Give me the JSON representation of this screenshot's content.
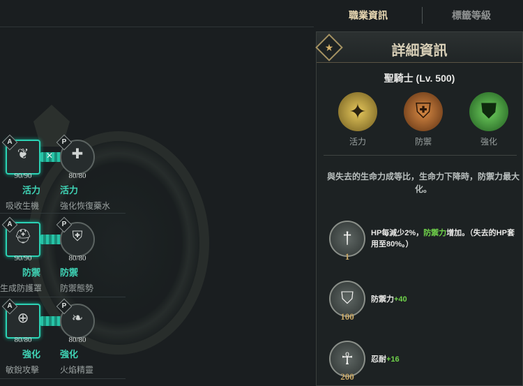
{
  "tabs": {
    "active": "職業資訊",
    "inactive": "標籤等級"
  },
  "panel": {
    "title": "詳細資訊",
    "class_name": "聖騎士 (Lv. 500)",
    "traits": [
      {
        "label": "活力",
        "icon": "vitality-icon",
        "color": "#c8a84a"
      },
      {
        "label": "防禦",
        "icon": "defense-icon",
        "color": "#c67a35"
      },
      {
        "label": "強化",
        "icon": "enhance-icon",
        "color": "#4fb04a"
      }
    ],
    "description": "與失去的生命力成等比，生命力下降時，防禦力最大化。",
    "nodes": [
      {
        "level": "1",
        "icon": "sword-icon",
        "pre": "HP每減少2%，",
        "hl": "防禦力",
        "post": "增加。（失去的HP套用至80%。）"
      },
      {
        "level": "100",
        "icon": "shield-icon",
        "pre": "防禦力",
        "hl": "+40",
        "post": ""
      },
      {
        "level": "200",
        "icon": "meditate-icon",
        "pre": "忍耐",
        "hl": "+16",
        "post": ""
      }
    ]
  },
  "skills": [
    {
      "a_count": "90/90",
      "p_count": "80/80",
      "a_cat": "活力",
      "p_cat": "活力",
      "a_name": "吸收生機",
      "p_name": "強化恢復藥水",
      "a_icon": "dragon-icon",
      "p_icon": "hp-potion-icon"
    },
    {
      "a_count": "90/90",
      "p_count": "80/80",
      "a_cat": "防禦",
      "p_cat": "防禦",
      "a_name": "生成防護罩",
      "p_name": "防禦態勢",
      "a_icon": "helmet-icon",
      "p_icon": "armor-icon"
    },
    {
      "a_count": "80/80",
      "p_count": "80/80",
      "a_cat": "強化",
      "p_cat": "強化",
      "a_name": "敏銳攻擊",
      "p_name": "火焰精靈",
      "a_icon": "target-icon",
      "p_icon": "flame-spirit-icon"
    }
  ],
  "slot_tags": {
    "a": "A",
    "p": "P"
  }
}
